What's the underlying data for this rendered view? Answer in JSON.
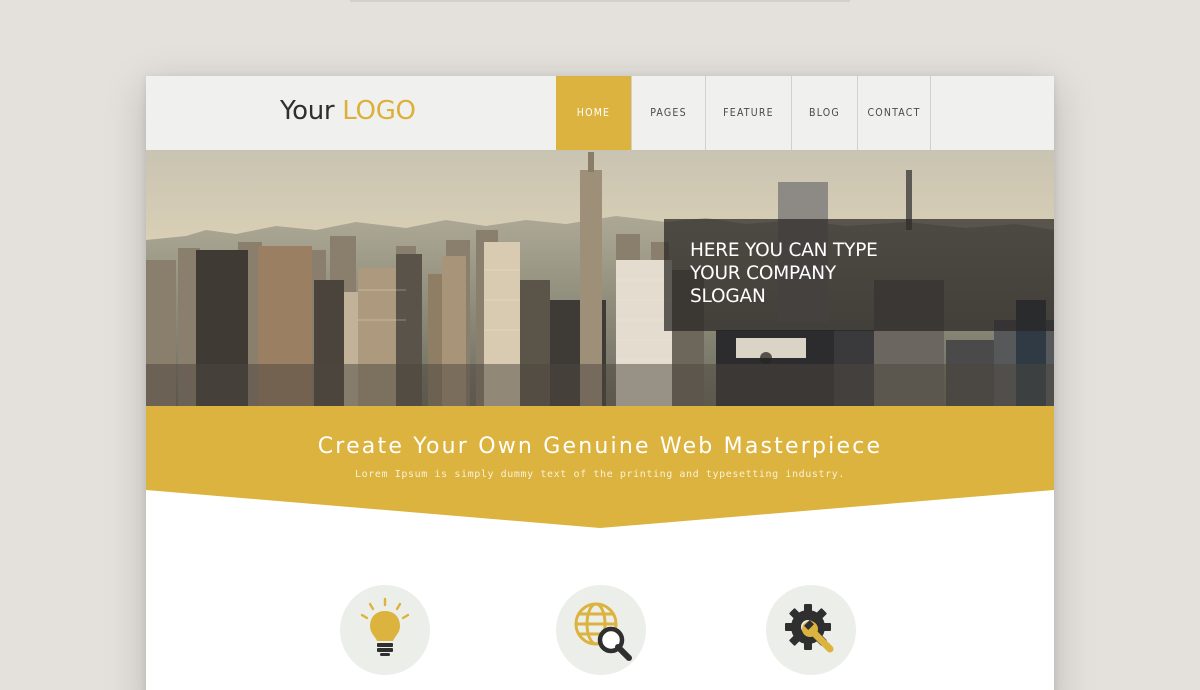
{
  "logo": {
    "text_main": "Your ",
    "text_accent": "LOGO"
  },
  "nav": {
    "items": [
      {
        "label": "HOME",
        "active": true
      },
      {
        "label": "PAGES",
        "active": false
      },
      {
        "label": "FEATURE",
        "active": false
      },
      {
        "label": "BLOG",
        "active": false
      },
      {
        "label": "CONTACT",
        "active": false
      }
    ]
  },
  "hero": {
    "slogan": "HERE YOU CAN TYPE\nYOUR COMPANY\nSLOGAN"
  },
  "band": {
    "title": "Create Your Own Genuine Web Masterpiece",
    "subtitle": "Lorem Ipsum is simply dummy text of the printing and typesetting industry."
  },
  "features": [
    {
      "icon": "lightbulb-icon"
    },
    {
      "icon": "globe-search-icon"
    },
    {
      "icon": "gear-wrench-icon"
    }
  ],
  "colors": {
    "accent": "#dcb33e",
    "header_bg": "#f0f1ee",
    "page_bg": "#e4e1dc",
    "dark": "#2f2f2f"
  }
}
